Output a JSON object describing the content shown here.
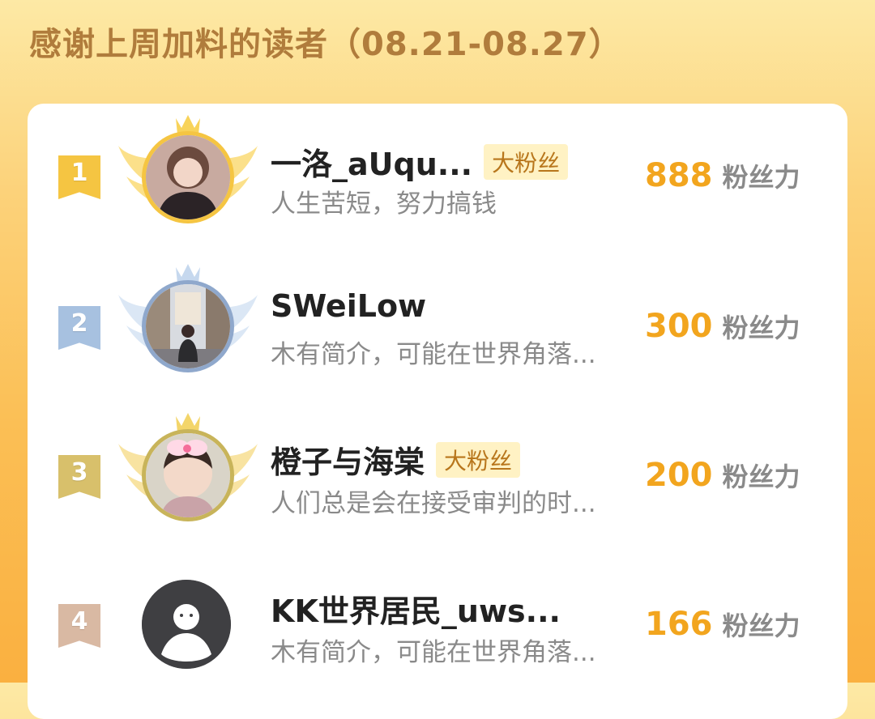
{
  "header": {
    "title": "感谢上周加料的读者（08.21-08.27）"
  },
  "colors": {
    "rank_1": "#f5c542",
    "rank_2": "#a7c1e0",
    "rank_3": "#d8c06b",
    "rank_4": "#d9b9a3",
    "score": "#f2a51e",
    "tag_bg": "#fff2c4",
    "tag_text": "#b8761c"
  },
  "leaderboard": [
    {
      "rank": "1",
      "name": "一洛_aUqu...",
      "tag": "大粉丝",
      "bio": "人生苦短，努力搞钱",
      "score": "888",
      "unit": "粉丝力",
      "avatar_icon": "user-photo-avatar",
      "decor_icon": "gold-crown-wings-icon"
    },
    {
      "rank": "2",
      "name": "SWeiLow",
      "tag": "",
      "bio": "木有简介，可能在世界角落...",
      "score": "300",
      "unit": "粉丝力",
      "avatar_icon": "user-photo-avatar",
      "decor_icon": "silver-crown-wings-icon"
    },
    {
      "rank": "3",
      "name": "橙子与海棠",
      "tag": "大粉丝",
      "bio": "人们总是会在接受审判的时...",
      "score": "200",
      "unit": "粉丝力",
      "avatar_icon": "user-photo-avatar",
      "decor_icon": "bronze-crown-wings-icon"
    },
    {
      "rank": "4",
      "name": "KK世界居民_uws...",
      "tag": "",
      "bio": "木有简介，可能在世界角落...",
      "score": "166",
      "unit": "粉丝力",
      "avatar_icon": "default-avatar-icon",
      "decor_icon": ""
    }
  ]
}
